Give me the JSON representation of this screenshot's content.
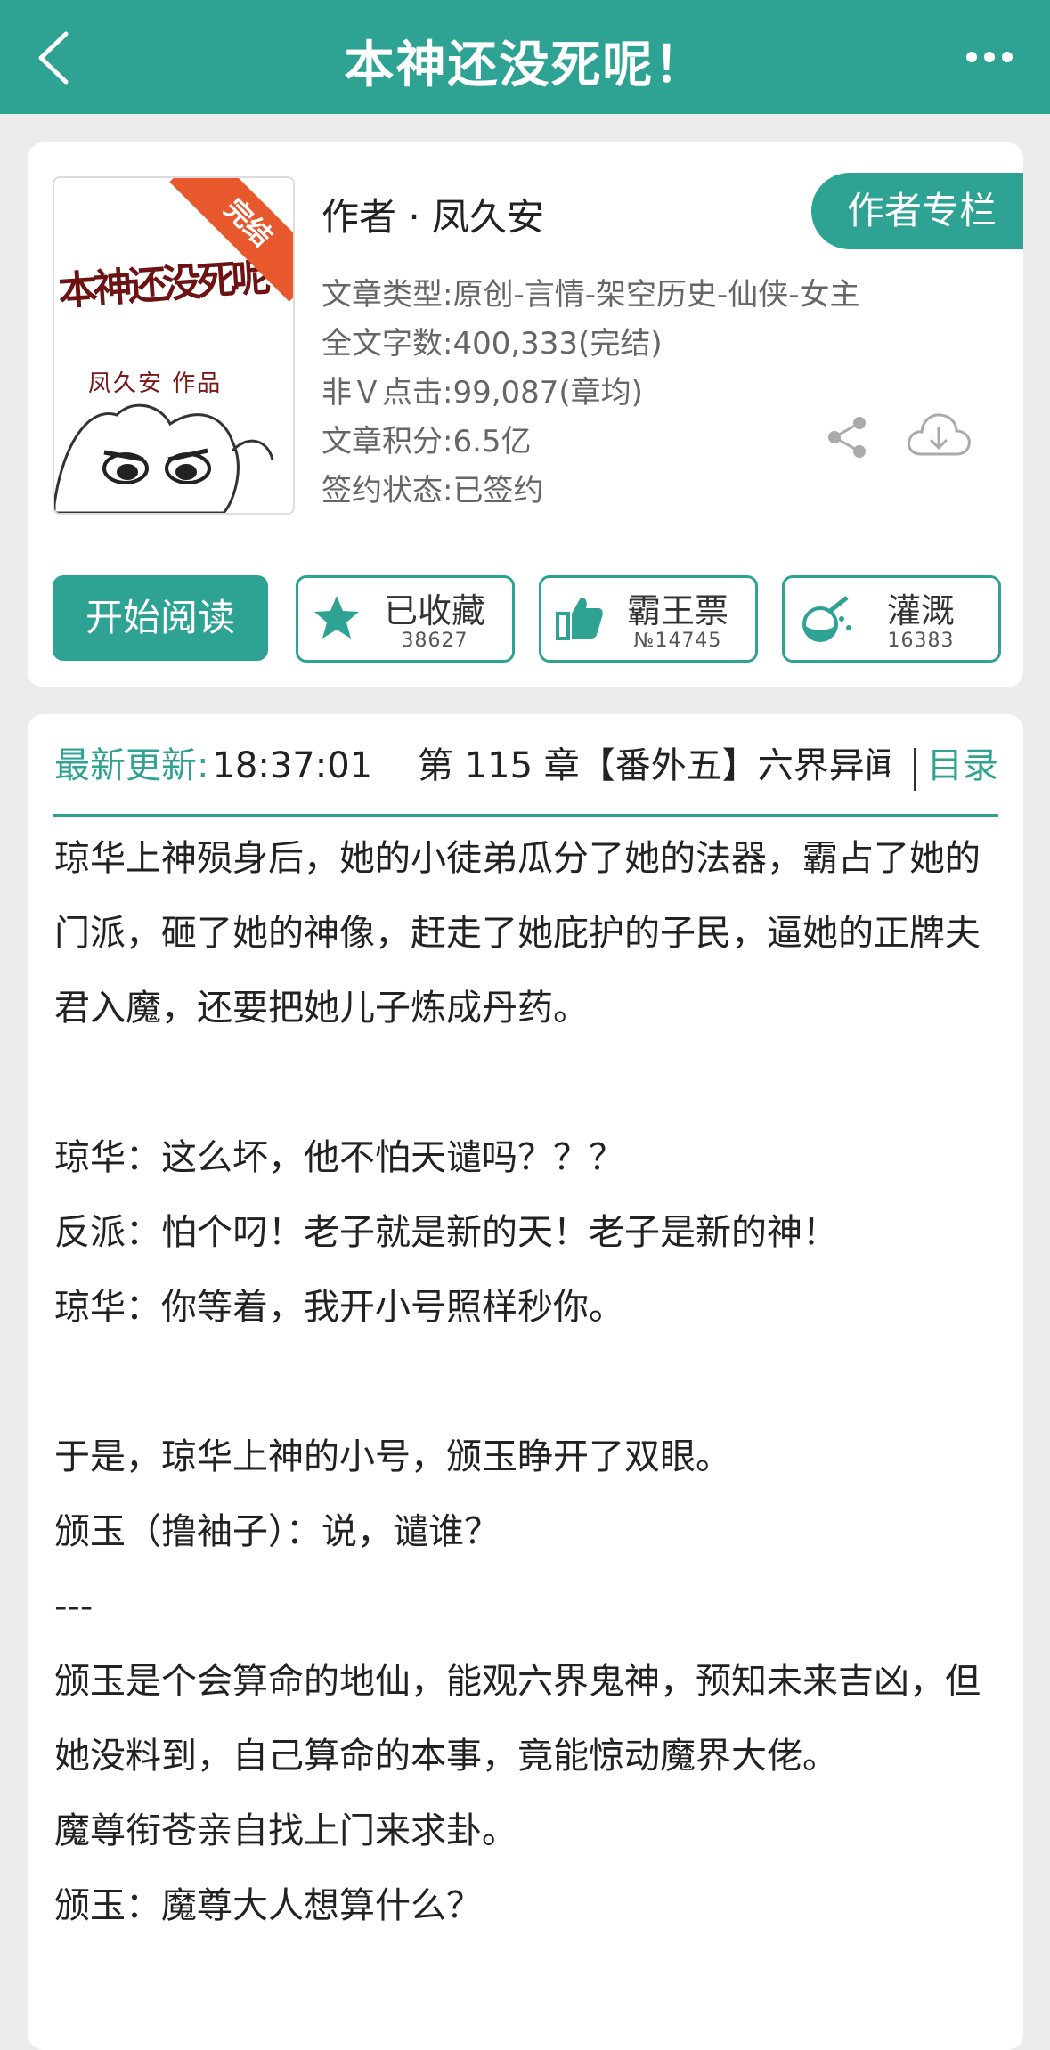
{
  "header": {
    "title": "本神还没死呢！"
  },
  "book": {
    "cover_title": "本神还没死呢",
    "cover_author": "凤久安 作品",
    "status_ribbon": "完结",
    "author": "作者 · 凤久安",
    "author_column_label": "作者专栏",
    "meta": [
      "文章类型:原创-言情-架空历史-仙侠-女主",
      "全文字数:400,333(完结)",
      "非Ｖ点击:99,087(章均)",
      "文章积分:6.5亿",
      "签约状态:已签约"
    ]
  },
  "actions": {
    "read_label": "开始阅读",
    "collect_label": "已收藏",
    "collect_count": "38627",
    "vote_label": "霸王票",
    "vote_count": "№14745",
    "water_label": "灌溉",
    "water_count": "16383"
  },
  "update": {
    "label": "最新更新:",
    "time": "18:37:01",
    "chapter": "第 115 章【番外五】六界异闻",
    "toc_label": "目录"
  },
  "description": "琼华上神殒身后，她的小徒弟瓜分了她的法器，霸占了她的门派，砸了她的神像，赶走了她庇护的子民，逼她的正牌夫君入魔，还要把她儿子炼成丹药。\n\n琼华：这么坏，他不怕天谴吗？？？\n反派：怕个叼！老子就是新的天！老子是新的神！\n琼华：你等着，我开小号照样秒你。\n\n于是，琼华上神的小号，颁玉睁开了双眼。\n颁玉（撸袖子）：说，谴谁？\n---\n颁玉是个会算命的地仙，能观六界鬼神，预知未来吉凶，但她没料到，自己算命的本事，竟能惊动魔界大佬。\n魔尊衔苍亲自找上门来求卦。\n颁玉：魔尊大人想算什么？",
  "colors": {
    "accent": "#2fa393",
    "ribbon": "#e7582d"
  }
}
